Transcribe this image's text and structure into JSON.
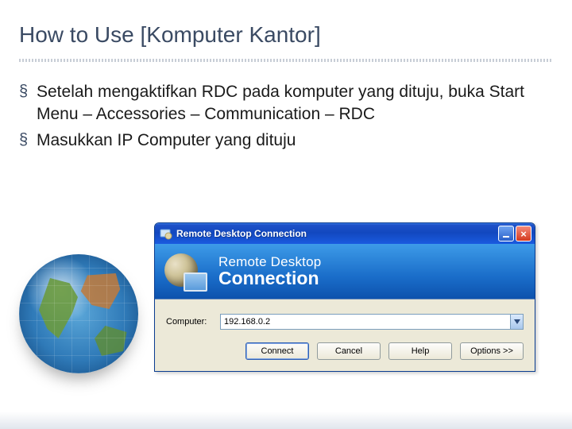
{
  "slide": {
    "title": "How to Use [Komputer Kantor]",
    "bullets": [
      "Setelah mengaktifkan RDC pada komputer yang dituju, buka Start Menu – Accessories – Communication – RDC",
      "Masukkan IP Computer yang dituju"
    ]
  },
  "rdc": {
    "window_title": "Remote Desktop Connection",
    "banner_line1": "Remote Desktop",
    "banner_line2": "Connection",
    "computer_label": "Computer:",
    "computer_value": "192.168.0.2",
    "buttons": {
      "connect": "Connect",
      "cancel": "Cancel",
      "help": "Help",
      "options": "Options >>"
    }
  }
}
